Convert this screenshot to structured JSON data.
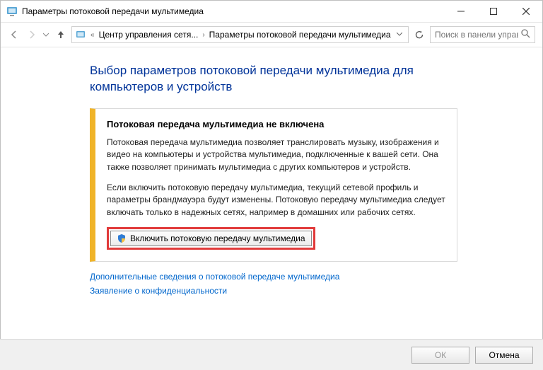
{
  "window": {
    "title": "Параметры потоковой передачи мультимедиа"
  },
  "breadcrumb": {
    "item1": "Центр управления сетя...",
    "item2": "Параметры потоковой передачи мультимедиа"
  },
  "search": {
    "placeholder": "Поиск в панели управления"
  },
  "heading": "Выбор параметров потоковой передачи мультимедиа для компьютеров и устройств",
  "panel": {
    "title": "Потоковая передача мультимедиа не включена",
    "p1": "Потоковая передача мультимедиа позволяет транслировать музыку, изображения и видео на компьютеры и устройства мультимедиа, подключенные к вашей сети. Она также позволяет принимать мультимедиа с других компьютеров и устройств.",
    "p2": "Если включить потоковую передачу мультимедиа, текущий сетевой профиль и параметры брандмауэра будут изменены. Потоковую передачу мультимедиа следует включать только в надежных сетях, например в домашних или рабочих сетях.",
    "button": "Включить потоковую передачу мультимедиа"
  },
  "links": {
    "more": "Дополнительные сведения о потоковой передаче мультимедиа",
    "privacy": "Заявление о конфиденциальности"
  },
  "footer": {
    "ok": "ОК",
    "cancel": "Отмена"
  }
}
